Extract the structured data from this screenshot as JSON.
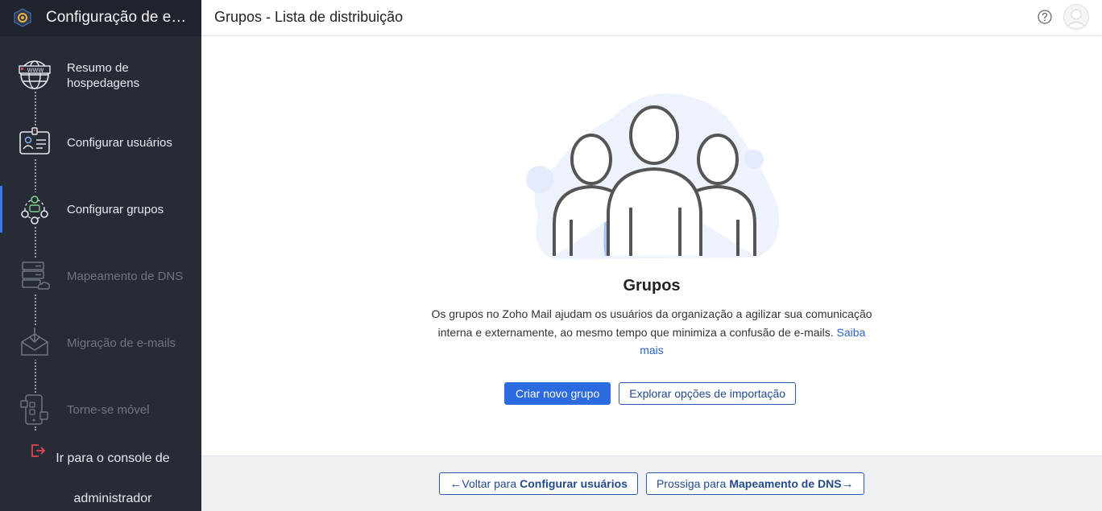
{
  "sidebar": {
    "title": "Configuração de e-mail",
    "steps": [
      {
        "label": "Resumo de hospedagens",
        "icon": "globe-www-icon",
        "state": "done"
      },
      {
        "label": "Configurar usuários",
        "icon": "id-card-icon",
        "state": "done"
      },
      {
        "label": "Configurar grupos",
        "icon": "group-network-icon",
        "state": "active"
      },
      {
        "label": "Mapeamento de DNS",
        "icon": "server-cloud-icon",
        "state": "disabled"
      },
      {
        "label": "Migração de e-mails",
        "icon": "inbox-download-icon",
        "state": "disabled"
      },
      {
        "label": "Torne-se móvel",
        "icon": "mobile-apps-icon",
        "state": "disabled"
      }
    ],
    "footer": {
      "label": "Ir para o console de administrador",
      "icon": "exit-icon"
    }
  },
  "header": {
    "title": "Grupos - Lista de distribuição"
  },
  "main": {
    "heading": "Grupos",
    "description": "Os grupos no Zoho Mail ajudam os usuários da organização a agilizar sua comunicação interna e externamente, ao mesmo tempo que minimiza a confusão de e-mails.",
    "learn_more": "Saiba mais",
    "primary_button": "Criar novo grupo",
    "secondary_button": "Explorar opções de importação"
  },
  "footer_nav": {
    "back_prefix": "Voltar para",
    "back_target": "Configurar usuários",
    "next_prefix": "Prossiga para",
    "next_target": "Mapeamento de DNS"
  },
  "colors": {
    "sidebar_bg": "#262b36",
    "accent": "#2c6bdf",
    "link": "#2f63c6"
  }
}
